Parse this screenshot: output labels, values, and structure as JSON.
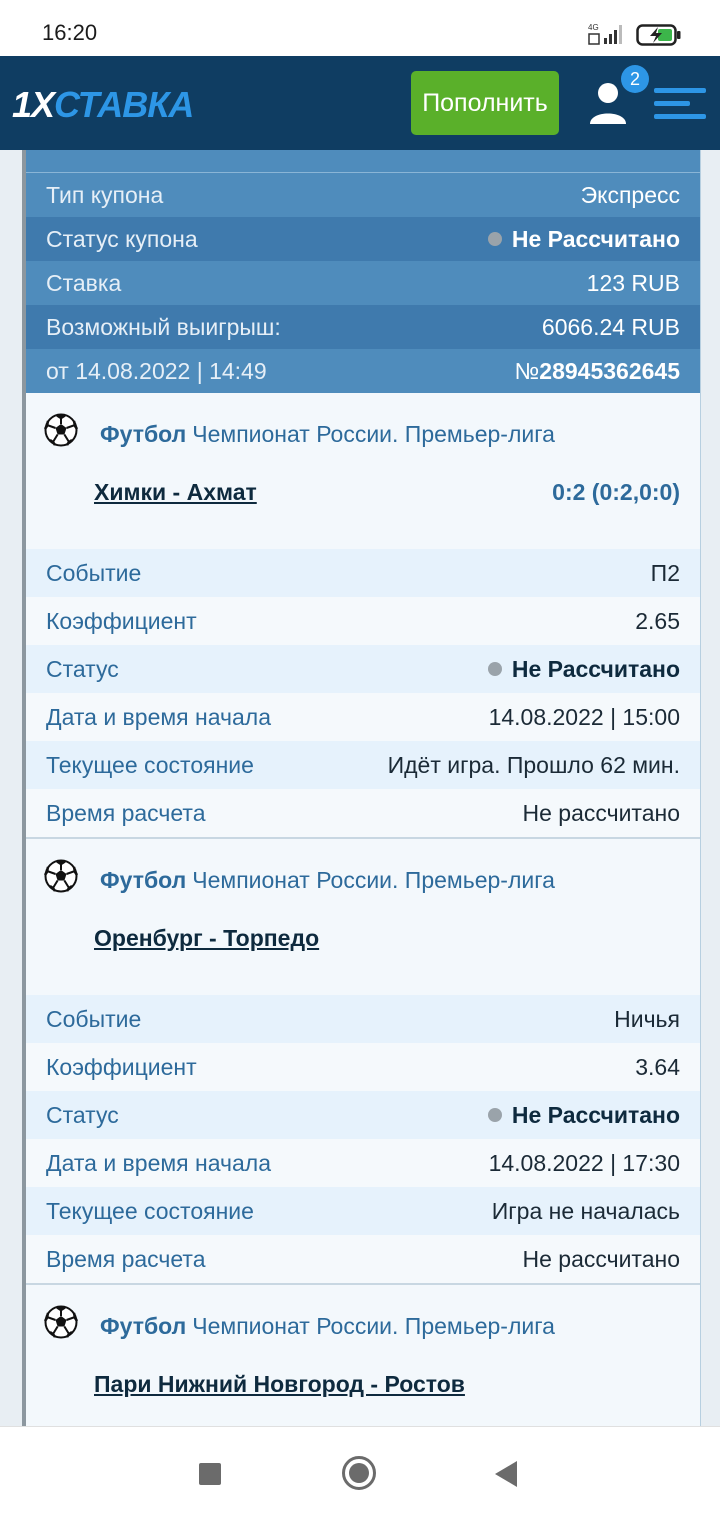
{
  "status_bar": {
    "time": "16:20",
    "network": "4G"
  },
  "header": {
    "logo_prefix": "1X",
    "logo_suffix": "СТАВКА",
    "deposit_label": "Пополнить",
    "notifications_count": "2",
    "colors": {
      "background": "#0f3d62",
      "deposit": "#5ab02a",
      "accent": "#2d96e6"
    }
  },
  "coupon": {
    "type_label": "Тип купона",
    "type_value": "Экспресс",
    "status_label": "Статус купона",
    "status_value": "Не Рассчитано",
    "stake_label": "Ставка",
    "stake_value": "123 RUB",
    "payout_label": "Возможный выигрыш:",
    "payout_value": "6066.24 RUB",
    "date": "от 14.08.2022 | 14:49",
    "number_prefix": "№",
    "number": "28945362645"
  },
  "events": [
    {
      "sport": "Футбол",
      "league": "Чемпионат России. Премьер-лига",
      "match": "Химки - Ахмат",
      "score": "0:2 (0:2,0:0)",
      "rows": {
        "event_label": "Событие",
        "event_value": "П2",
        "coef_label": "Коэффициент",
        "coef_value": "2.65",
        "status_label": "Статус",
        "status_value": "Не Рассчитано",
        "start_label": "Дата и время начала",
        "start_value": "14.08.2022 | 15:00",
        "state_label": "Текущее состояние",
        "state_value": "Идёт игра. Прошло 62 мин.",
        "calc_label": "Время расчета",
        "calc_value": "Не рассчитано"
      }
    },
    {
      "sport": "Футбол",
      "league": "Чемпионат России. Премьер-лига",
      "match": "Оренбург - Торпедо",
      "score": "",
      "rows": {
        "event_label": "Событие",
        "event_value": "Ничья",
        "coef_label": "Коэффициент",
        "coef_value": "3.64",
        "status_label": "Статус",
        "status_value": "Не Рассчитано",
        "start_label": "Дата и время начала",
        "start_value": "14.08.2022 | 17:30",
        "state_label": "Текущее состояние",
        "state_value": "Игра не началась",
        "calc_label": "Время расчета",
        "calc_value": "Не рассчитано"
      }
    },
    {
      "sport": "Футбол",
      "league": "Чемпионат России. Премьер-лига",
      "match": "Пари Нижний Новгород - Ростов",
      "score": ""
    }
  ],
  "icons": {
    "ball": "soccer-ball-icon",
    "user": "user-icon",
    "menu": "hamburger-menu-icon",
    "nav_recent": "square-icon",
    "nav_home": "circle-home-icon",
    "nav_back": "triangle-back-icon"
  }
}
